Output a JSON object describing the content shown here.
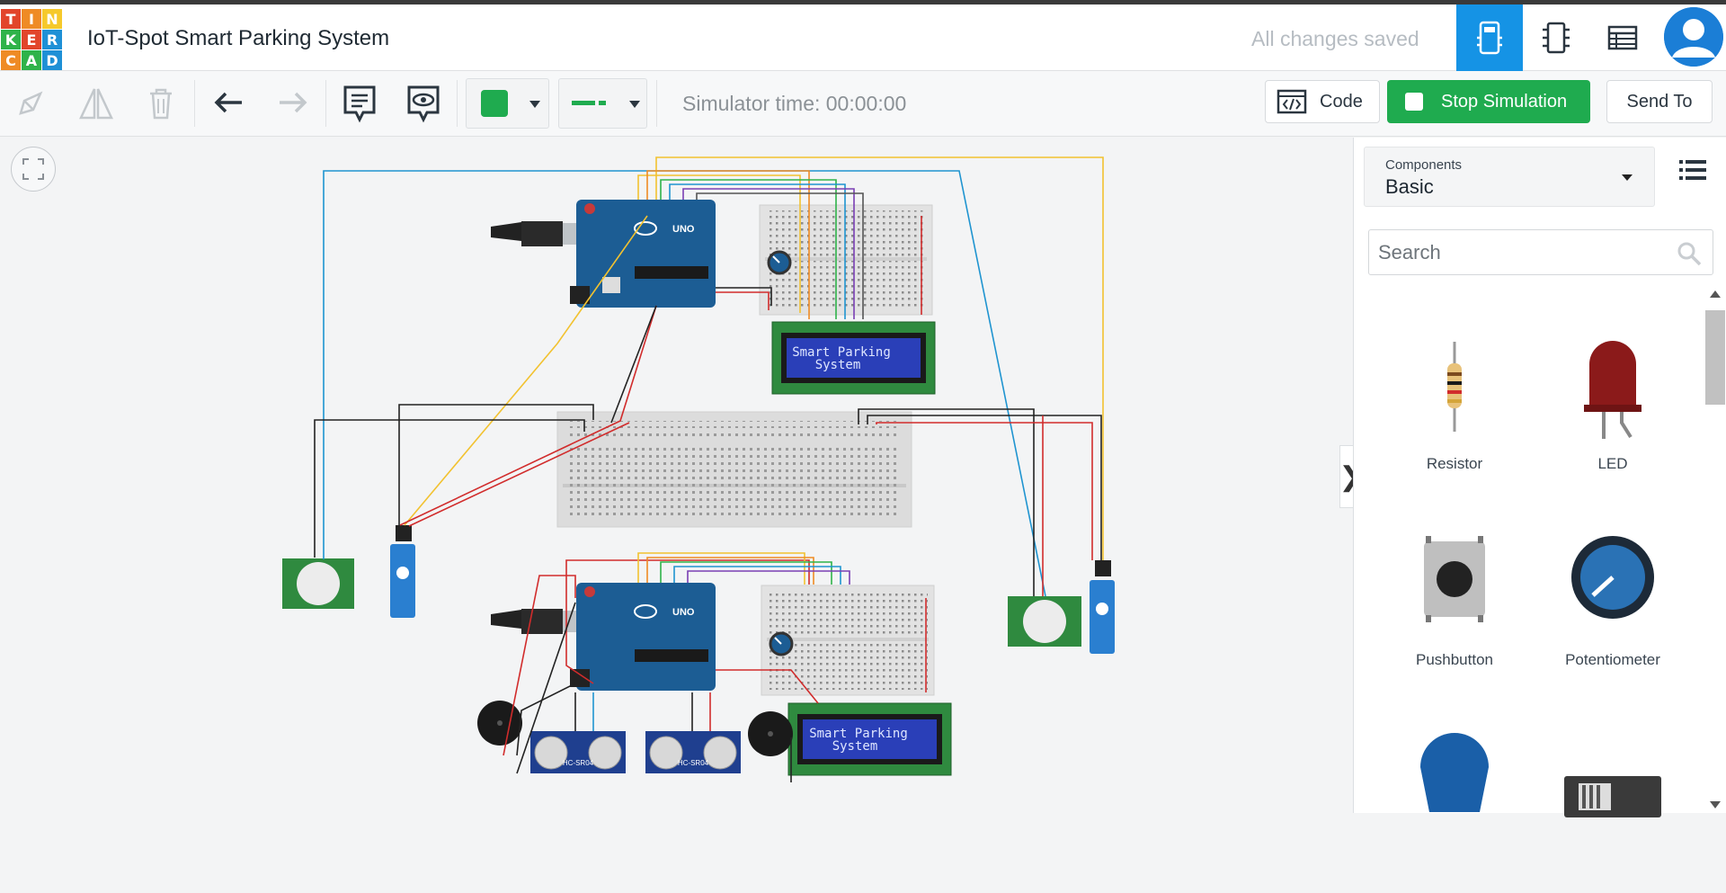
{
  "app": {
    "logo_letters": [
      "T",
      "I",
      "N",
      "K",
      "E",
      "R",
      "C",
      "A",
      "D"
    ],
    "logo_colors": [
      "#e2452b",
      "#ef8b25",
      "#f6c92b",
      "#2fb34a",
      "#e2452b",
      "#1e90d6",
      "#ef8b25",
      "#2fb34a",
      "#1e90d6"
    ],
    "project_title": "IoT-Spot Smart Parking System",
    "save_status": "All changes saved"
  },
  "header": {
    "view_buttons": [
      {
        "name": "circuit-view-icon",
        "active": true
      },
      {
        "name": "schematic-view-icon",
        "active": false
      },
      {
        "name": "component-list-icon",
        "active": false
      }
    ]
  },
  "toolbar": {
    "simulator_time": "Simulator time: 00:00:00",
    "code_label": "Code",
    "stop_label": "Stop Simulation",
    "send_label": "Send To",
    "color_value": "#1fab4f",
    "accent": "#1593e5"
  },
  "panel": {
    "components_label": "Components",
    "components_value": "Basic",
    "search_placeholder": "Search",
    "items": [
      {
        "label": "Resistor"
      },
      {
        "label": "LED"
      },
      {
        "label": "Pushbutton"
      },
      {
        "label": "Potentiometer"
      },
      {
        "label": ""
      },
      {
        "label": ""
      }
    ]
  },
  "canvas": {
    "lcd_top_text": [
      "Smart Parking",
      "System"
    ],
    "lcd_bottom_text": [
      "Smart Parking",
      "System"
    ],
    "arduino_label": "UNO",
    "ultrasonic_label": "HC-SR04"
  }
}
